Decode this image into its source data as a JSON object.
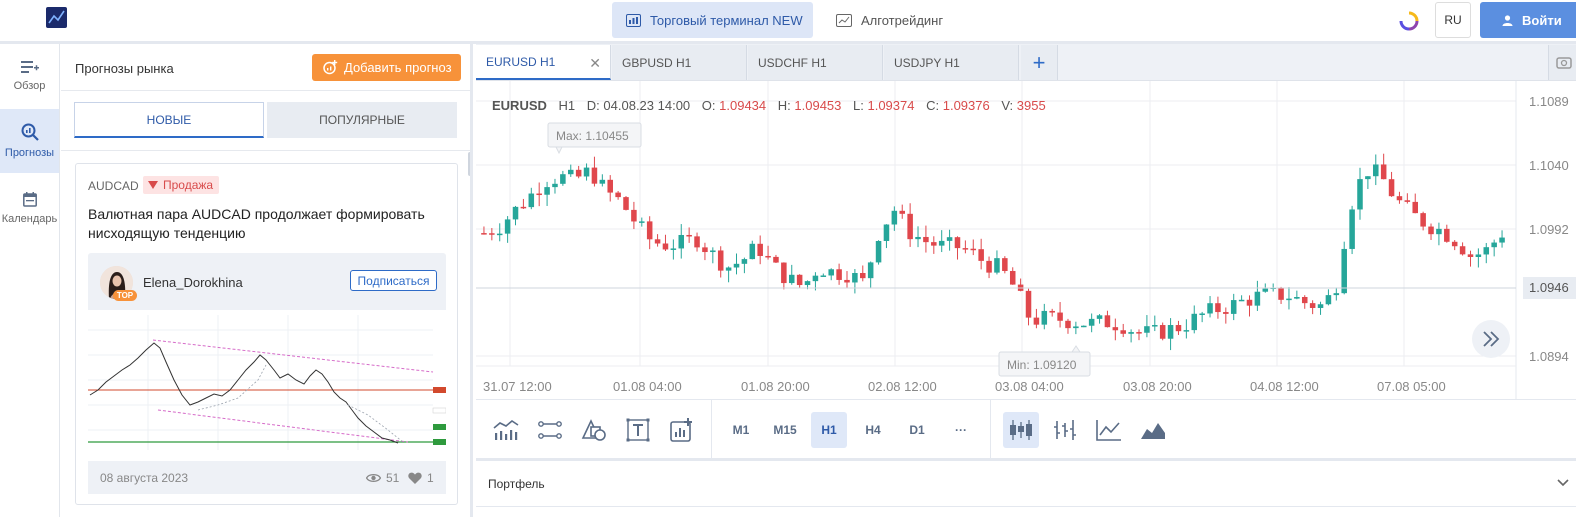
{
  "header": {
    "terminal_label": "Торговый терминал NEW",
    "algo_label": "Алготрейдинг",
    "lang": "RU",
    "login_label": "Войти"
  },
  "leftnav": {
    "items": [
      {
        "label": "Обзор",
        "icon": "overview-icon",
        "active": false
      },
      {
        "label": "Прогнозы",
        "icon": "forecast-search-icon",
        "active": true
      },
      {
        "label": "Календарь",
        "icon": "calendar-icon",
        "active": false
      }
    ]
  },
  "forecasts": {
    "title": "Прогнозы рынка",
    "add_label": "Добавить прогноз",
    "tabs": [
      "НОВЫЕ",
      "ПОПУЛЯРНЫЕ"
    ],
    "card": {
      "pair": "AUDCAD",
      "direction": "Продажа",
      "title": "Валютная пара AUDCAD продолжает формировать нисходящую тенденцию",
      "author": "Elena_Dorokhina",
      "author_badge": "TOP",
      "subscribe_label": "Подписаться",
      "date": "08 августа 2023",
      "views": "51",
      "likes": "1"
    }
  },
  "chart_tabs": [
    {
      "label": "EURUSD H1",
      "active": true
    },
    {
      "label": "GBPUSD H1",
      "active": false
    },
    {
      "label": "USDCHF H1",
      "active": false
    },
    {
      "label": "USDJPY H1",
      "active": false
    }
  ],
  "ohlc": {
    "symbol": "EURUSD",
    "timeframe": "H1",
    "date_label": "D:",
    "date": "04.08.23 14:00",
    "open_label": "O:",
    "open": "1.09434",
    "high_label": "H:",
    "high": "1.09453",
    "low_label": "L:",
    "low": "1.09374",
    "close_label": "C:",
    "close": "1.09376",
    "volume_label": "V:",
    "volume": "3955"
  },
  "chart_data": {
    "type": "candlestick",
    "symbol": "EURUSD",
    "timeframe": "H1",
    "y_ticks": [
      "1.1089",
      "1.1040",
      "1.0992",
      "1.0946",
      "1.0894"
    ],
    "current_price": "1.0946",
    "x_ticks": [
      "31.07 12:00",
      "01.08 04:00",
      "01.08 20:00",
      "02.08 12:00",
      "03.08 04:00",
      "03.08 20:00",
      "04.08 12:00",
      "07.08 05:00"
    ],
    "max_label": "Max: 1.10455",
    "min_label": "Min: 1.09120",
    "close_path": [
      1.0988,
      1.0993,
      1.1005,
      1.1016,
      1.1028,
      1.1031,
      1.1029,
      1.1036,
      1.102,
      1.1012,
      1.0996,
      1.0982,
      1.0979,
      1.098,
      1.0984,
      1.0972,
      1.0962,
      1.0967,
      1.0978,
      1.0963,
      1.0953,
      1.0947,
      1.0962,
      1.0958,
      1.0957,
      1.095,
      1.0989,
      1.1006,
      1.0989,
      1.0982,
      1.0978,
      1.0978,
      1.0974,
      1.0965,
      1.0961,
      1.0945,
      1.0921,
      1.0923,
      1.0922,
      1.092,
      1.0919,
      1.092,
      1.0918,
      1.0912,
      1.0911,
      1.0914,
      1.0917,
      1.0924,
      1.0929,
      1.0932,
      1.0936,
      1.094,
      1.0941,
      1.094,
      1.0935,
      1.0932,
      1.0943,
      1.1008,
      1.1037,
      1.1032,
      1.1014,
      1.1003,
      1.0995,
      1.099,
      1.0982,
      1.097,
      1.0975,
      1.0988
    ]
  },
  "toolbar": {
    "timeframes": [
      "M1",
      "M15",
      "H1",
      "H4",
      "D1"
    ],
    "active_timeframe": "H1",
    "more": "···"
  },
  "portfolio": {
    "title": "Портфель"
  },
  "colors": {
    "up": "#26a69a",
    "down": "#e0474c",
    "accent": "#2e6bc7",
    "orange": "#f7923a"
  }
}
